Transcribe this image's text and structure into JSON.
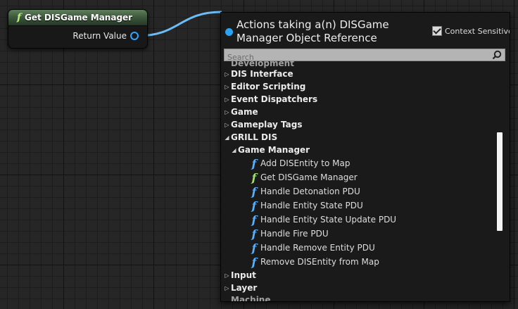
{
  "node": {
    "title": "Get DISGame Manager",
    "function_icon": "f",
    "output_pin_label": "Return Value"
  },
  "menu": {
    "title": "Actions taking a(n) DISGame Manager Object Reference",
    "context_sensitive_label": "Context Sensitive",
    "context_sensitive_checked": true,
    "search_placeholder": "Search",
    "top_partial_label": "Development",
    "bottom_partial_label": "Machine",
    "categories_top": [
      {
        "label": "DIS Interface"
      },
      {
        "label": "Editor Scripting"
      },
      {
        "label": "Event Dispatchers"
      },
      {
        "label": "Game"
      },
      {
        "label": "Gameplay Tags"
      }
    ],
    "expanded_category": "GRILL DIS",
    "subcategory": "Game Manager",
    "actions": [
      {
        "label": "Add DISEntity to Map",
        "icon": "function-icon",
        "color": "#59b0ff"
      },
      {
        "label": "Get DISGame Manager",
        "icon": "pure-function-icon",
        "color": "#9fe06a"
      },
      {
        "label": "Handle Detonation PDU",
        "icon": "function-icon",
        "color": "#59b0ff"
      },
      {
        "label": "Handle Entity State PDU",
        "icon": "function-icon",
        "color": "#59b0ff"
      },
      {
        "label": "Handle Entity State Update PDU",
        "icon": "function-icon",
        "color": "#59b0ff"
      },
      {
        "label": "Handle Fire PDU",
        "icon": "function-icon",
        "color": "#59b0ff"
      },
      {
        "label": "Handle Remove Entity PDU",
        "icon": "function-icon",
        "color": "#59b0ff"
      },
      {
        "label": "Remove DISEntity from Map",
        "icon": "function-icon",
        "color": "#59b0ff"
      }
    ],
    "categories_bottom": [
      {
        "label": "Input"
      },
      {
        "label": "Layer"
      }
    ]
  },
  "colors": {
    "pin_blue": "#2fa5ff",
    "wire_blue": "#6cbcf5",
    "node_header_green": "#3e5a3d"
  }
}
